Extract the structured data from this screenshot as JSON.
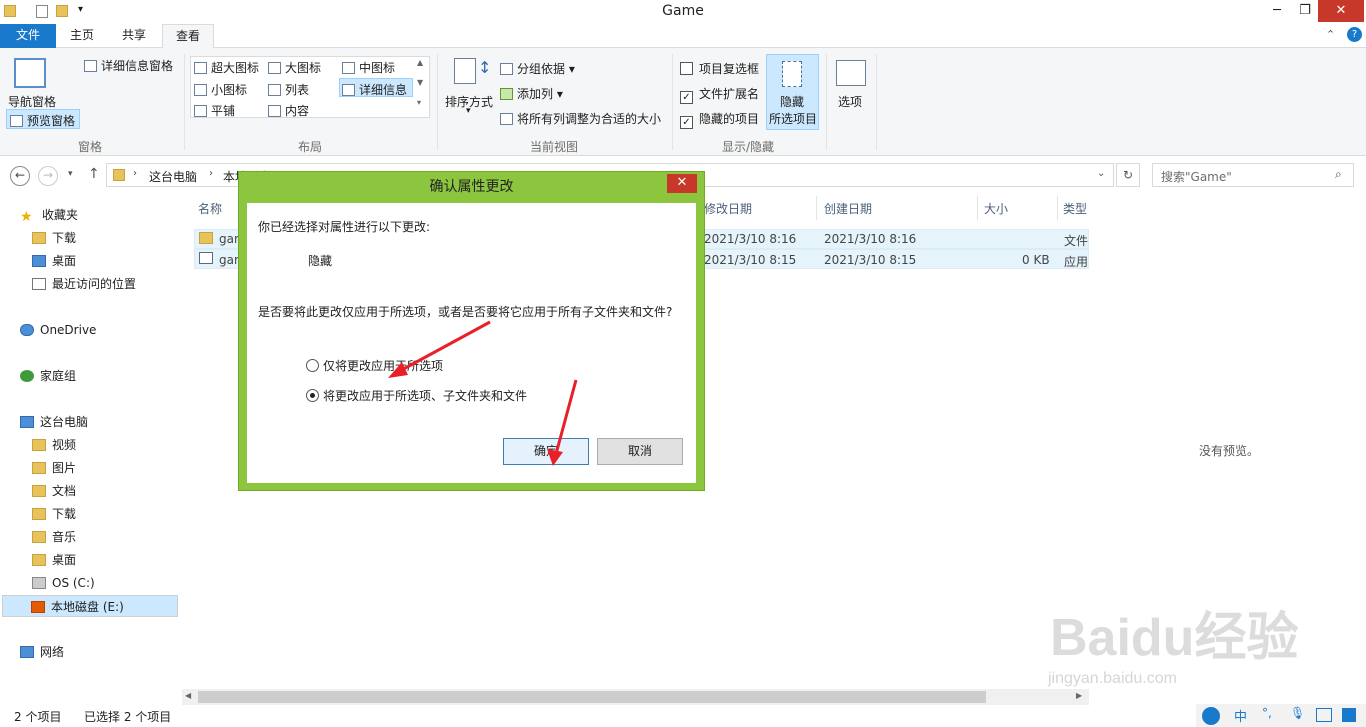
{
  "window": {
    "title": "Game",
    "min": "─",
    "max": "❐",
    "close": "✕"
  },
  "tabs": {
    "file": "文件",
    "home": "主页",
    "share": "共享",
    "view": "查看"
  },
  "ribbon": {
    "panes": {
      "nav_pane": "导航窗格",
      "preview_pane": "预览窗格",
      "details_pane": "详细信息窗格",
      "label": "窗格"
    },
    "layout": {
      "items": [
        "超大图标",
        "大图标",
        "中图标",
        "小图标",
        "列表",
        "详细信息",
        "平铺",
        "内容"
      ],
      "label": "布局"
    },
    "current_view": {
      "sort": "排序方式",
      "group": "分组依据",
      "add_col": "添加列",
      "fit_cols": "将所有列调整为合适的大小",
      "label": "当前视图"
    },
    "show_hide": {
      "item_checkbox": "项目复选框",
      "file_ext": "文件扩展名",
      "hidden_items": "隐藏的项目",
      "hide_selected_1": "隐藏",
      "hide_selected_2": "所选项目",
      "label": "显示/隐藏"
    },
    "options": "选项"
  },
  "address": {
    "path_1": "这台电脑",
    "path_2": "本地磁盘 (E:)",
    "search_placeholder": "搜索\"Game\""
  },
  "nav": {
    "favorites": "收藏夹",
    "downloads": "下载",
    "desktop": "桌面",
    "recent": "最近访问的位置",
    "onedrive": "OneDrive",
    "homegroup": "家庭组",
    "thispc": "这台电脑",
    "videos": "视频",
    "pictures": "图片",
    "documents": "文档",
    "downloads2": "下载",
    "music": "音乐",
    "desktop2": "桌面",
    "os_c": "OS (C:)",
    "local_e": "本地磁盘 (E:)",
    "network": "网络"
  },
  "columns": {
    "name": "名称",
    "modified": "修改日期",
    "created": "创建日期",
    "size": "大小",
    "type": "类型"
  },
  "files": [
    {
      "name": "gar",
      "modified": "2021/3/10 8:16",
      "created": "2021/3/10 8:16",
      "size": "",
      "type": "文件"
    },
    {
      "name": "gar",
      "modified": "2021/3/10 8:15",
      "created": "2021/3/10 8:15",
      "size": "0 KB",
      "type": "应用"
    }
  ],
  "preview": "没有预览。",
  "status": {
    "count": "2 个项目",
    "selected": "已选择 2 个项目"
  },
  "dialog": {
    "title": "确认属性更改",
    "intro": "你已经选择对属性进行以下更改:",
    "change": "隐藏",
    "question": "是否要将此更改仅应用于所选项，或者是否要将它应用于所有子文件夹和文件?",
    "option1": "仅将更改应用于所选项",
    "option2": "将更改应用于所选项、子文件夹和文件",
    "ok": "确定",
    "cancel": "取消"
  },
  "tray": {
    "ime": "中"
  },
  "watermark": {
    "brand": "Baidu经验",
    "url": "jingyan.baidu.com"
  },
  "colors": {
    "accent": "#1979ca",
    "dialog_frame": "#8cc63e",
    "close_red": "#c7372a",
    "arrow": "#e8202a"
  }
}
